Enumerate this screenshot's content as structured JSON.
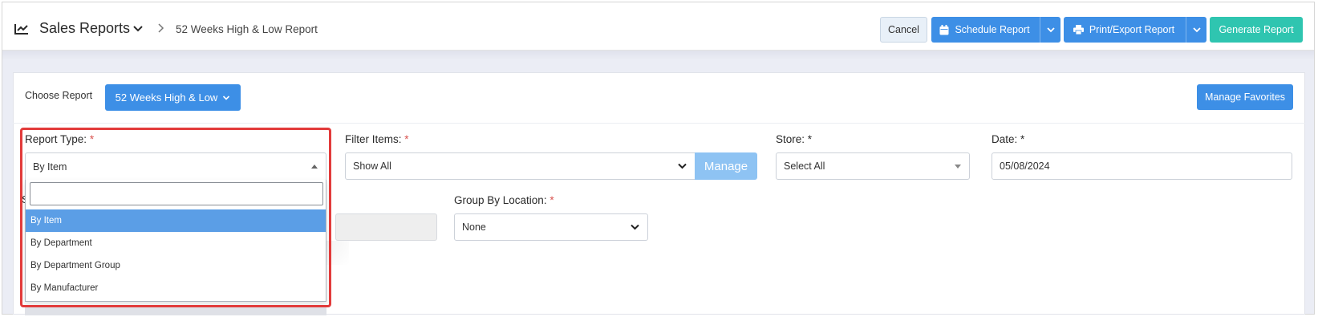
{
  "header": {
    "title": "Sales Reports",
    "breadcrumb": "52 Weeks High & Low Report",
    "buttons": {
      "cancel": "Cancel",
      "schedule": "Schedule Report",
      "print_export": "Print/Export Report",
      "generate": "Generate Report"
    }
  },
  "report_bar": {
    "choose_label": "Choose Report",
    "selected_report": "52 Weeks High & Low",
    "manage_favorites": "Manage Favorites"
  },
  "filters": {
    "report_type": {
      "label": "Report Type:",
      "value": "By Item",
      "search_value": "",
      "options": [
        "By Item",
        "By Department",
        "By Department Group",
        "By Manufacturer"
      ],
      "active_index": 0
    },
    "filter_items": {
      "label": "Filter Items:",
      "value": "Show All",
      "manage": "Manage"
    },
    "store": {
      "label": "Store:",
      "value": "Select All"
    },
    "date": {
      "label": "Date:",
      "value": "05/08/2024"
    },
    "group_by_location": {
      "label": "Group By Location:",
      "value": "None"
    },
    "hidden_label_fragment": "S",
    "required_mark": "*"
  },
  "colors": {
    "primary": "#3d8fe6",
    "teal": "#2fc5b0",
    "highlight_border": "#e23b3b",
    "active_option": "#5b9ee6",
    "required": "#d9534f"
  },
  "icons": [
    "chart-line-icon",
    "chevron-down-icon",
    "chevron-right-icon",
    "calendar-icon",
    "printer-icon",
    "caret-up-icon",
    "caret-down-icon"
  ]
}
